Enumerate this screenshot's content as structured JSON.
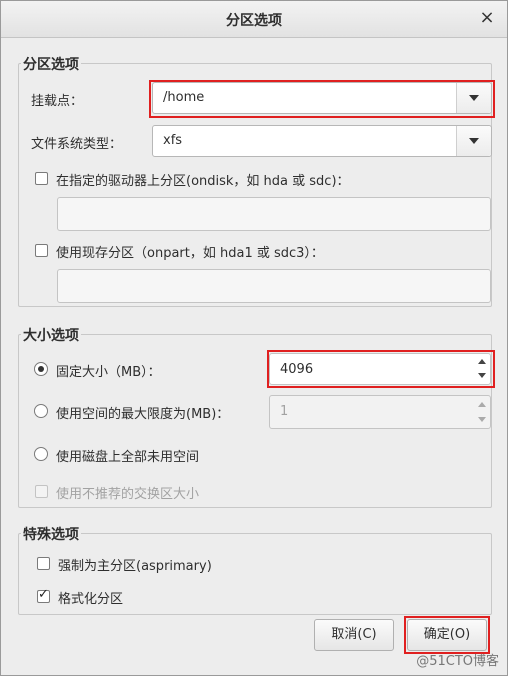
{
  "window": {
    "title": "分区选项",
    "close_icon": "close-icon"
  },
  "partition_options": {
    "title": "分区选项",
    "mount_point_label": "挂载点：",
    "mount_point_value": "/home",
    "fs_type_label": "文件系统类型：",
    "fs_type_value": "xfs",
    "ondisk_label": "在指定的驱动器上分区(ondisk，如 hda 或 sdc)：",
    "ondisk_checked": false,
    "ondisk_value": "",
    "onpart_label": "使用现存分区（onpart，如 hda1 或 sdc3）：",
    "onpart_checked": false,
    "onpart_value": ""
  },
  "size_options": {
    "title": "大小选项",
    "fixed_label": "固定大小（MB）：",
    "fixed_value": "4096",
    "max_label": "使用空间的最大限度为(MB)：",
    "max_value": "1",
    "fill_label": "使用磁盘上全部未用空间",
    "recommended_swap_label": "使用不推荐的交换区大小",
    "selected": "fixed"
  },
  "special_options": {
    "title": "特殊选项",
    "primary_label": "强制为主分区(asprimary)",
    "primary_checked": false,
    "format_label": "格式化分区",
    "format_checked": true
  },
  "buttons": {
    "cancel": "取消(C)",
    "ok": "确定(O)"
  },
  "watermark": "@51CTO博客"
}
